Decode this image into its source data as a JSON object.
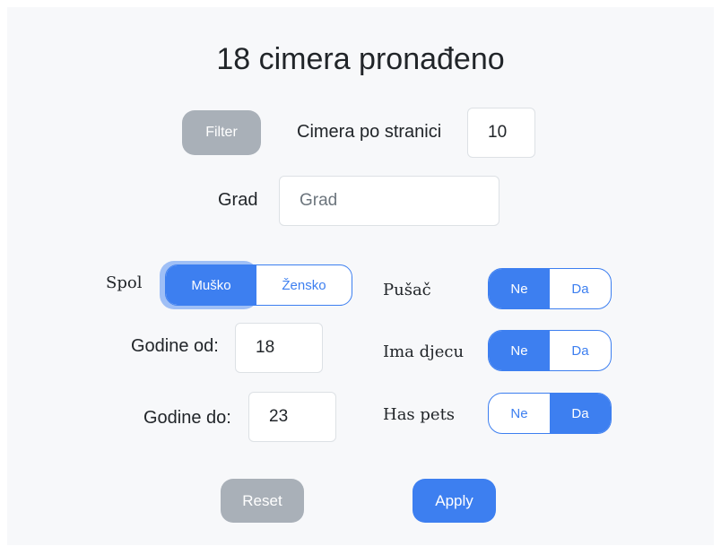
{
  "title": "18 cimera pronađeno",
  "filter_button": "Filter",
  "per_page": {
    "label": "Cimera po stranici",
    "value": "10"
  },
  "city": {
    "label": "Grad",
    "placeholder": "Grad",
    "value": ""
  },
  "gender": {
    "label": "Spol",
    "options": [
      "Muško",
      "Žensko"
    ],
    "selected": "Muško"
  },
  "age_from": {
    "label": "Godine od:",
    "value": "18"
  },
  "age_to": {
    "label": "Godine do:",
    "value": "23"
  },
  "smoker": {
    "label": "Pušač",
    "options": [
      "Ne",
      "Da"
    ],
    "selected": "Ne"
  },
  "has_kids": {
    "label": "Ima djecu",
    "options": [
      "Ne",
      "Da"
    ],
    "selected": "Ne"
  },
  "has_pets": {
    "label": "Has pets",
    "options": [
      "Ne",
      "Da"
    ],
    "selected": "Da"
  },
  "reset_button": "Reset",
  "apply_button": "Apply",
  "colors": {
    "accent": "#3d7ff0",
    "disabled": "#a9b0b8",
    "panel": "#f7f8fa"
  }
}
